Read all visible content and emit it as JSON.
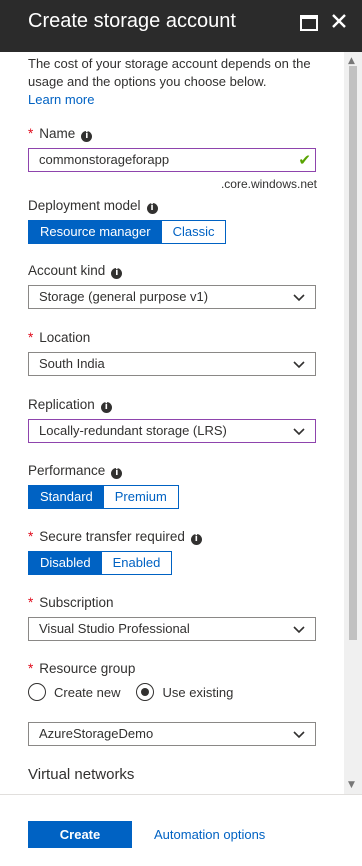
{
  "header": {
    "title": "Create storage account"
  },
  "intro": {
    "text": "The cost of your storage account depends on the usage and the options you choose below.",
    "learn_more": "Learn more"
  },
  "name": {
    "label": "Name",
    "value": "commonstorageforapp",
    "suffix": ".core.windows.net"
  },
  "deployment_model": {
    "label": "Deployment model",
    "options": [
      "Resource manager",
      "Classic"
    ],
    "selected": "Resource manager"
  },
  "account_kind": {
    "label": "Account kind",
    "value": "Storage (general purpose v1)"
  },
  "location": {
    "label": "Location",
    "value": "South India"
  },
  "replication": {
    "label": "Replication",
    "value": "Locally-redundant storage (LRS)"
  },
  "performance": {
    "label": "Performance",
    "options": [
      "Standard",
      "Premium"
    ],
    "selected": "Standard"
  },
  "secure_transfer": {
    "label": "Secure transfer required",
    "options": [
      "Disabled",
      "Enabled"
    ],
    "selected": "Disabled"
  },
  "subscription": {
    "label": "Subscription",
    "value": "Visual Studio Professional"
  },
  "resource_group": {
    "label": "Resource group",
    "options": [
      "Create new",
      "Use existing"
    ],
    "selected": "Use existing",
    "value": "AzureStorageDemo"
  },
  "virtual_networks": {
    "label": "Virtual networks"
  },
  "footer": {
    "create": "Create",
    "automation": "Automation options"
  },
  "colors": {
    "accent": "#0062c3",
    "header_bg": "#2b2b2b",
    "required": "#e00b1c",
    "valid": "#57a300",
    "highlight_border": "#8e44ad"
  },
  "icons": {
    "maximize": "maximize-icon",
    "close": "close-icon",
    "info": "info-icon",
    "caret": "chevron-down-icon",
    "check": "checkmark-icon"
  }
}
